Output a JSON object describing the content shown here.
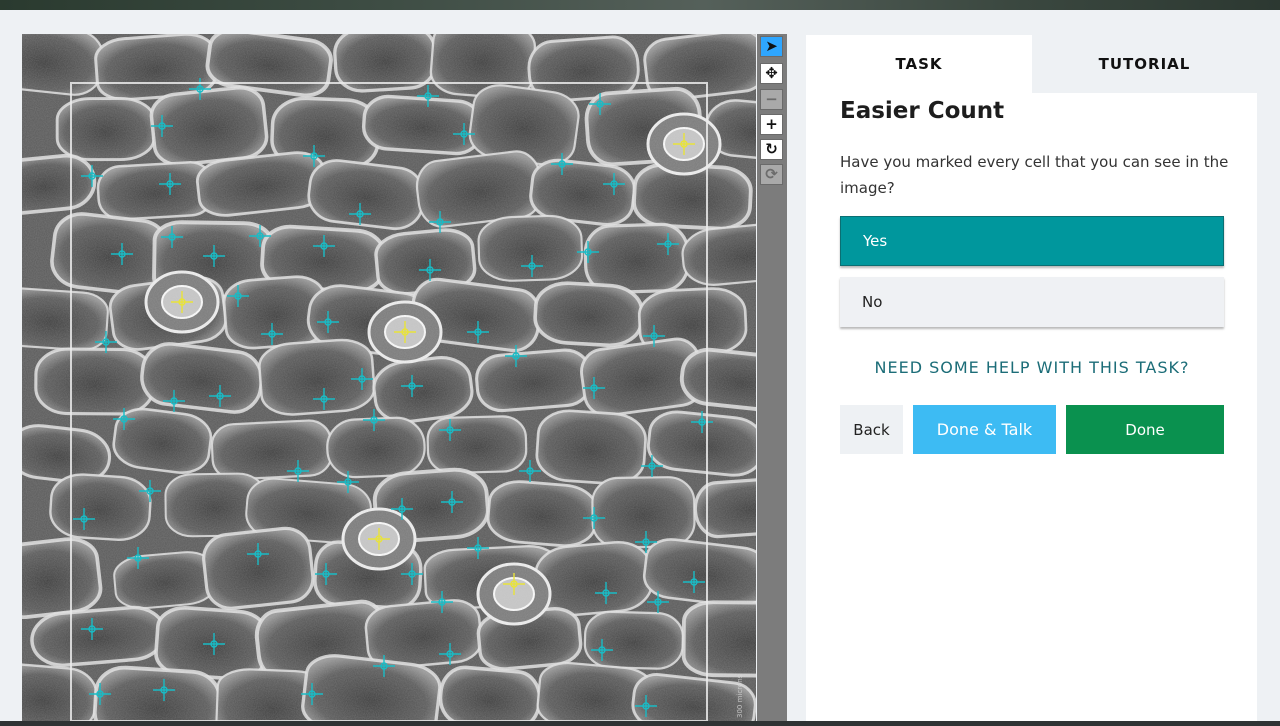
{
  "toolbar": {
    "tools": [
      {
        "name": "pointer-tool",
        "icon": "pointer-icon",
        "glyph": "➤",
        "state": "active"
      },
      {
        "name": "pan-tool",
        "icon": "move-icon",
        "glyph": "✥",
        "state": "normal"
      },
      {
        "name": "zoom-out-tool",
        "icon": "minus-icon",
        "glyph": "−",
        "state": "disabled"
      },
      {
        "name": "zoom-in-tool",
        "icon": "plus-icon",
        "glyph": "+",
        "state": "normal"
      },
      {
        "name": "rotate-tool",
        "icon": "rotate-icon",
        "glyph": "↻",
        "state": "normal"
      },
      {
        "name": "reset-tool",
        "icon": "reset-icon",
        "glyph": "⟳",
        "state": "disabled"
      }
    ]
  },
  "viewer": {
    "scale_label": "300 microns"
  },
  "tabs": {
    "task": "TASK",
    "tutorial": "TUTORIAL"
  },
  "task": {
    "title": "Easier Count",
    "question": "Have you marked every cell that you can see in the image?",
    "answers": {
      "yes": "Yes",
      "no": "No"
    },
    "selected_answer": "yes",
    "help": "NEED SOME HELP WITH THIS TASK?"
  },
  "buttons": {
    "back": "Back",
    "done_talk": "Done & Talk",
    "done": "Done"
  },
  "colors": {
    "cell_marker": "#19bcc6",
    "stoma_marker": "#e9e33a",
    "selected_answer": "#00979d",
    "done_talk": "#3dbbf3",
    "done": "#0a914f",
    "active_tool": "#2ea6ff"
  }
}
